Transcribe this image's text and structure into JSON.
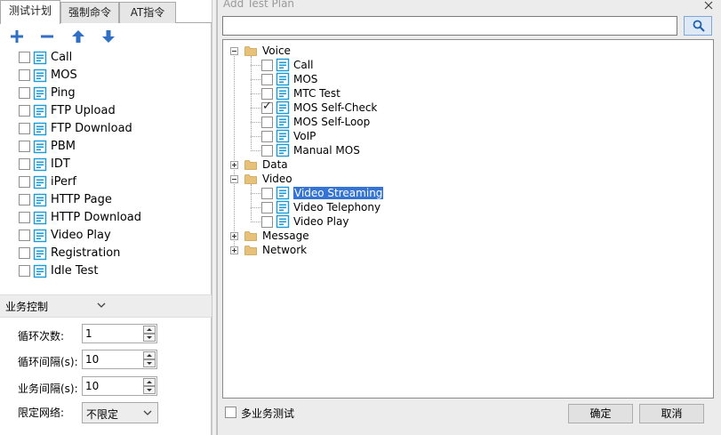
{
  "left_panel": {
    "tabs": [
      {
        "label": "测试计划"
      },
      {
        "label": "强制命令"
      },
      {
        "label": "AT指令"
      }
    ],
    "toolbar": {
      "add": "add-icon",
      "remove": "remove-icon",
      "up": "arrow-up-icon",
      "down": "arrow-down-icon"
    },
    "plans": [
      {
        "label": "Call"
      },
      {
        "label": "MOS"
      },
      {
        "label": "Ping"
      },
      {
        "label": "FTP Upload"
      },
      {
        "label": "FTP Download"
      },
      {
        "label": "PBM"
      },
      {
        "label": "IDT"
      },
      {
        "label": "iPerf"
      },
      {
        "label": "HTTP Page"
      },
      {
        "label": "HTTP Download"
      },
      {
        "label": "Video Play"
      },
      {
        "label": "Registration"
      },
      {
        "label": "Idle Test"
      }
    ],
    "control": {
      "title": "业务控制",
      "loop_count_label": "循环次数:",
      "loop_count_value": "1",
      "loop_interval_label": "循环间隔(s):",
      "loop_interval_value": "10",
      "service_interval_label": "业务间隔(s):",
      "service_interval_value": "10",
      "network_label": "限定网络:",
      "network_value": "不限定"
    }
  },
  "dialog": {
    "title": "Add Test Plan",
    "search_value": "",
    "tree": {
      "voice": {
        "label": "Voice",
        "children": [
          {
            "label": "Call",
            "checked": false
          },
          {
            "label": "MOS",
            "checked": false
          },
          {
            "label": "MTC Test",
            "checked": false
          },
          {
            "label": "MOS Self-Check",
            "checked": true
          },
          {
            "label": "MOS Self-Loop",
            "checked": false
          },
          {
            "label": "VoIP",
            "checked": false
          },
          {
            "label": "Manual MOS",
            "checked": false
          }
        ]
      },
      "data": {
        "label": "Data"
      },
      "video": {
        "label": "Video",
        "children": [
          {
            "label": "Video Streaming",
            "checked": false,
            "selected": true
          },
          {
            "label": "Video Telephony",
            "checked": false
          },
          {
            "label": "Video Play",
            "checked": false
          }
        ]
      },
      "message": {
        "label": "Message"
      },
      "network": {
        "label": "Network"
      }
    },
    "multi_service_label": "多业务测试",
    "ok_label": "确定",
    "cancel_label": "取消"
  },
  "colors": {
    "accent_blue": "#2f6fc4",
    "selection": "#3574d4",
    "folder": "#e8c179",
    "doc_icon": "#1a9ad6"
  }
}
